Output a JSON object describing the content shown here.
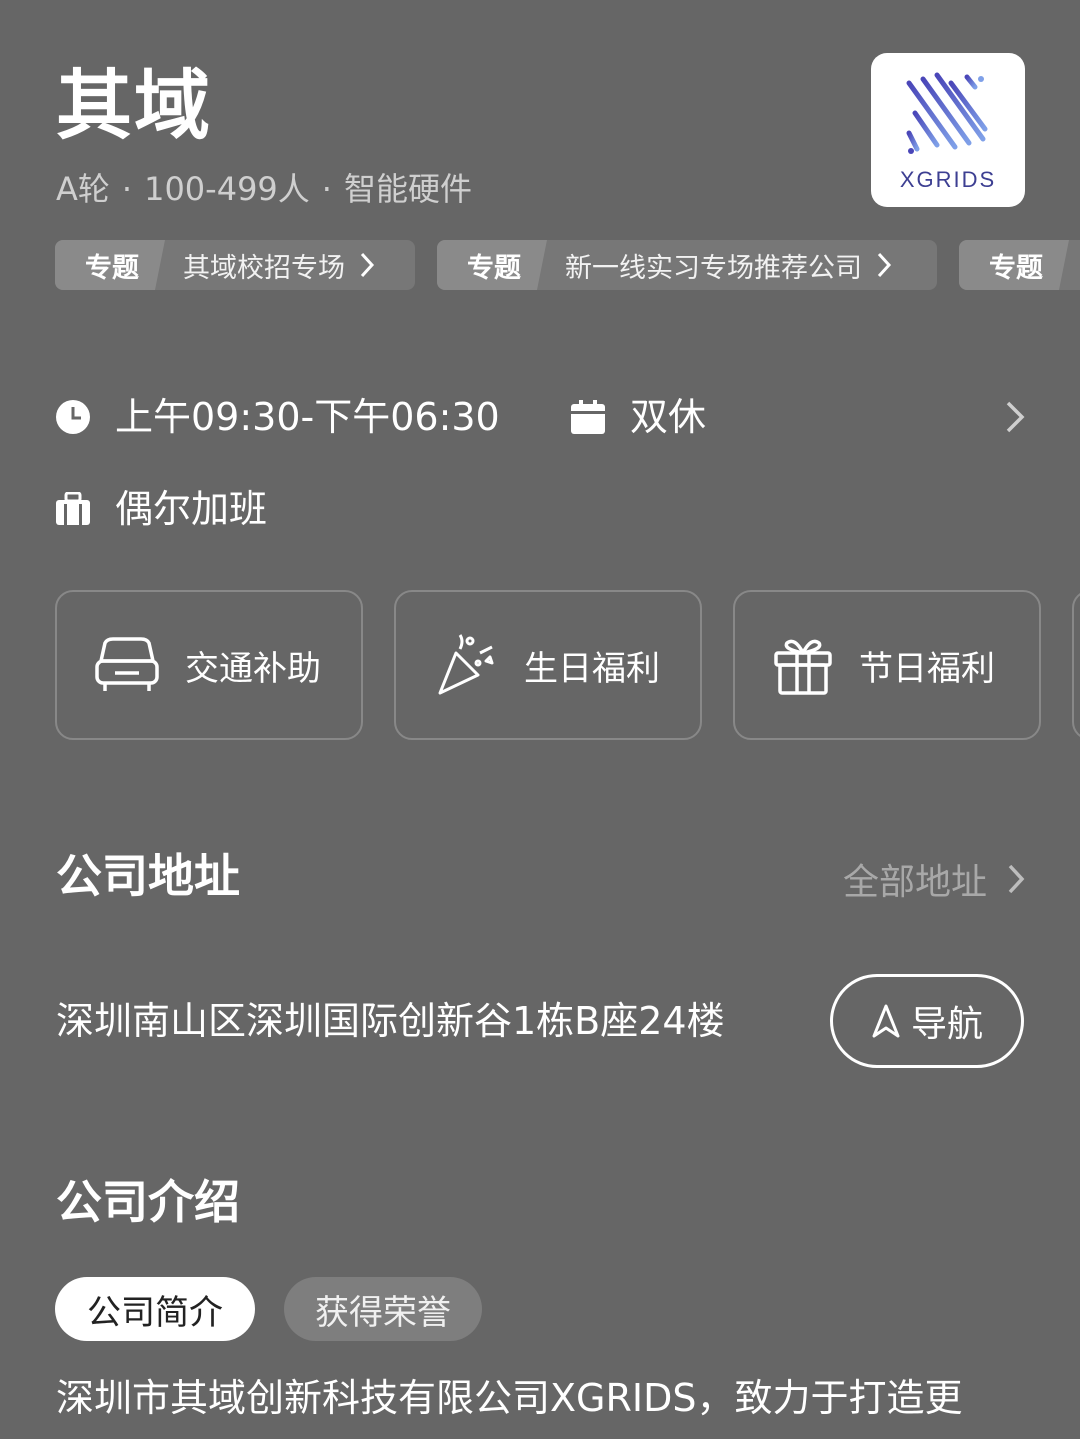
{
  "company": {
    "name": "其域",
    "round": "A轮",
    "size": "100-499人",
    "industry": "智能硬件",
    "logo_text": "XGRIDS"
  },
  "topics": [
    {
      "tag": "专题",
      "label": "其域校招专场"
    },
    {
      "tag": "专题",
      "label": "新一线实习专场推荐公司"
    },
    {
      "tag": "专题",
      "label": ""
    }
  ],
  "work_info": {
    "hours": "上午09:30-下午06:30",
    "rest": "双休",
    "overtime": "偶尔加班"
  },
  "benefits": [
    {
      "label": "交通补助",
      "icon": "car-icon"
    },
    {
      "label": "生日福利",
      "icon": "party-popper-icon"
    },
    {
      "label": "节日福利",
      "icon": "gift-icon"
    }
  ],
  "address_section": {
    "title": "公司地址",
    "all_label": "全部地址",
    "address": "深圳南山区深圳国际创新谷1栋B座24楼",
    "nav_label": "导航"
  },
  "intro_section": {
    "title": "公司介绍",
    "tabs": [
      "公司简介",
      "获得荣誉"
    ],
    "text": "深圳市其域创新科技有限公司XGRIDS，致力于打造更"
  },
  "colors": {
    "background": "#666666",
    "logo_accent": "#5b5fc7"
  }
}
